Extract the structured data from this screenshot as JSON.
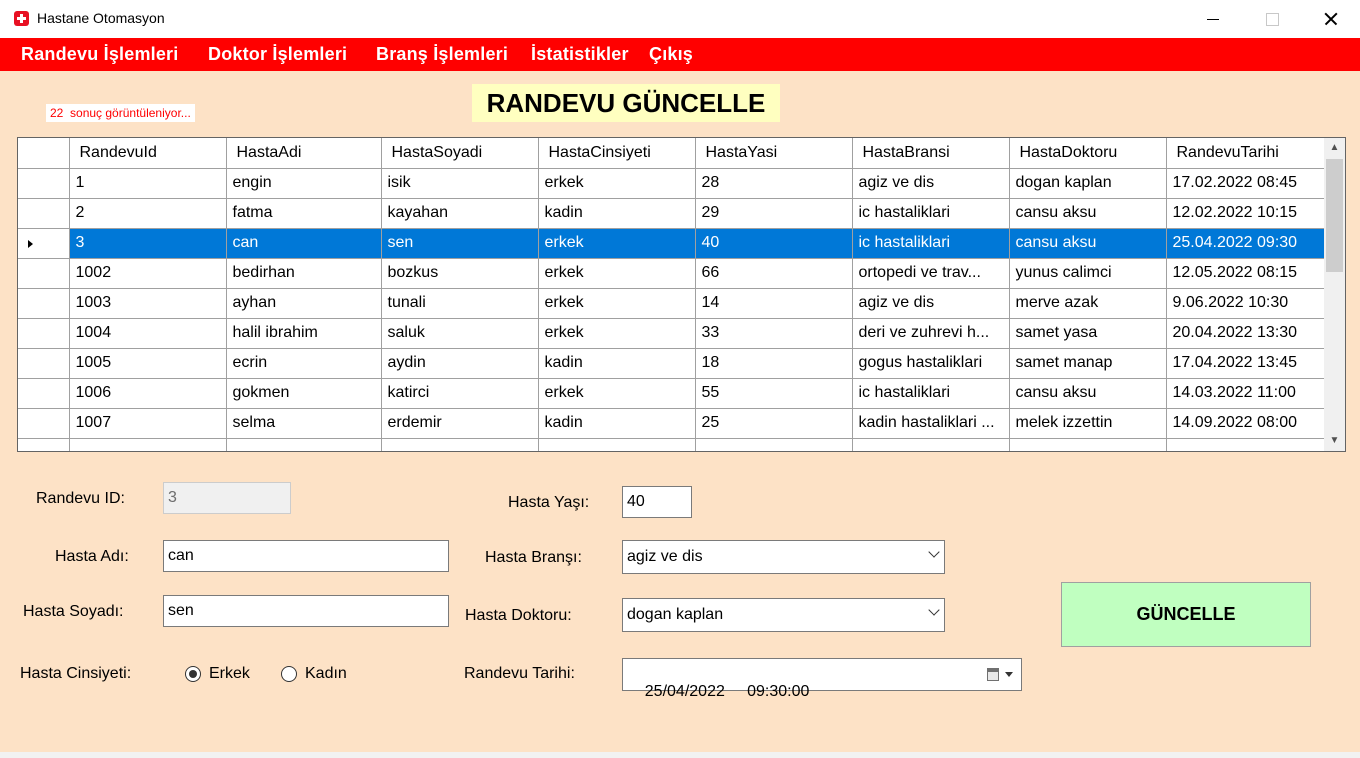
{
  "window": {
    "title": "Hastane Otomasyon",
    "icon": "hospital-cross-icon"
  },
  "menu": {
    "items": [
      "Randevu İşlemleri",
      "Doktor İşlemleri",
      "Branş İşlemleri",
      "İstatistikler",
      "Çıkış"
    ]
  },
  "result_count": {
    "number": "22",
    "text": "sonuç görüntüleniyor..."
  },
  "page_title": "RANDEVU GÜNCELLE",
  "grid": {
    "columns": [
      "RandevuId",
      "HastaAdi",
      "HastaSoyadi",
      "HastaCinsiyeti",
      "HastaYasi",
      "HastaBransi",
      "HastaDoktoru",
      "RandevuTarihi"
    ],
    "selected_index": 2,
    "rows": [
      [
        "1",
        "engin",
        "isik",
        "erkek",
        "28",
        "agiz ve dis",
        "dogan kaplan",
        "17.02.2022 08:45"
      ],
      [
        "2",
        "fatma",
        "kayahan",
        "kadin",
        "29",
        "ic hastaliklari",
        "cansu aksu",
        "12.02.2022 10:15"
      ],
      [
        "3",
        "can",
        "sen",
        "erkek",
        "40",
        "ic hastaliklari",
        "cansu aksu",
        "25.04.2022 09:30"
      ],
      [
        "1002",
        "bedirhan",
        "bozkus",
        "erkek",
        "66",
        "ortopedi ve trav...",
        "yunus calimci",
        "12.05.2022 08:15"
      ],
      [
        "1003",
        "ayhan",
        "tunali",
        "erkek",
        "14",
        "agiz ve dis",
        "merve azak",
        "9.06.2022 10:30"
      ],
      [
        "1004",
        "halil ibrahim",
        "saluk",
        "erkek",
        "33",
        "deri ve zuhrevi h...",
        "samet yasa",
        "20.04.2022 13:30"
      ],
      [
        "1005",
        "ecrin",
        "aydin",
        "kadin",
        "18",
        "gogus hastaliklari",
        "samet manap",
        "17.04.2022 13:45"
      ],
      [
        "1006",
        "gokmen",
        "katirci",
        "erkek",
        "55",
        "ic hastaliklari",
        "cansu aksu",
        "14.03.2022 11:00"
      ],
      [
        "1007",
        "selma",
        "erdemir",
        "kadin",
        "25",
        "kadin hastaliklari ...",
        "melek izzettin",
        "14.09.2022 08:00"
      ]
    ]
  },
  "form": {
    "randevu_id": {
      "label": "Randevu ID:",
      "value": "3"
    },
    "hasta_adi": {
      "label": "Hasta Adı:",
      "value": "can"
    },
    "hasta_soyadi": {
      "label": "Hasta Soyadı:",
      "value": "sen"
    },
    "hasta_cinsiyeti": {
      "label": "Hasta Cinsiyeti:",
      "options": [
        "Erkek",
        "Kadın"
      ],
      "selected": "Erkek"
    },
    "hasta_yasi": {
      "label": "Hasta Yaşı:",
      "value": "40"
    },
    "hasta_bransi": {
      "label": "Hasta Branşı:",
      "value": "agiz ve dis"
    },
    "hasta_doktoru": {
      "label": "Hasta Doktoru:",
      "value": "dogan kaplan"
    },
    "randevu_tarihi": {
      "label": "Randevu Tarihi:",
      "value": "25/04/2022     09:30:00"
    }
  },
  "buttons": {
    "update": "GÜNCELLE"
  },
  "colors": {
    "menu_bg": "#ff0000",
    "form_bg": "#fde2c6",
    "title_bg": "#ffffc0",
    "selection": "#0078d7",
    "update_button": "#c0ffc0",
    "count_text": "#ff0000"
  }
}
